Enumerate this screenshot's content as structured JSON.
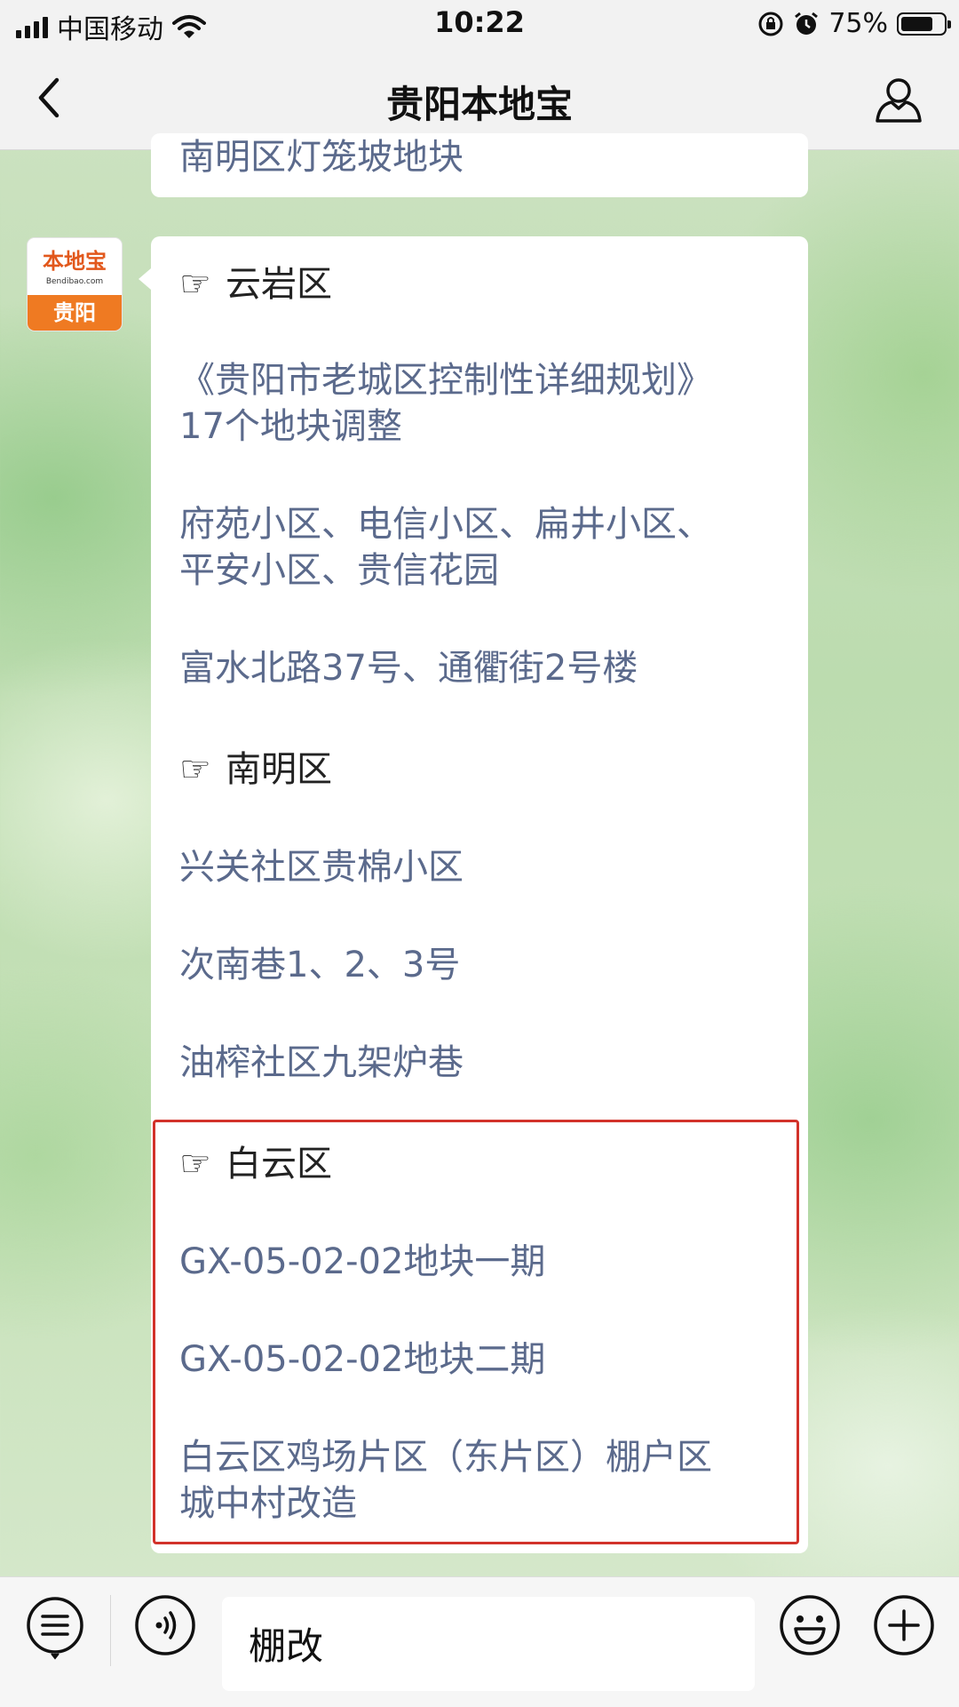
{
  "status_bar": {
    "carrier": "中国移动",
    "time": "10:22",
    "battery_percent": "75%",
    "battery_level": 0.75,
    "icons": [
      "signal-icon",
      "wifi-icon",
      "orientation-lock-icon",
      "alarm-icon",
      "battery-icon"
    ]
  },
  "nav": {
    "title": "贵阳本地宝",
    "back_icon": "chevron-left-icon",
    "profile_icon": "person-icon"
  },
  "previous_message": {
    "partial_text": "南明区灯笼坡地块"
  },
  "avatar": {
    "brand_text": "本地宝",
    "site_text": "Bendibao.com",
    "city_text": "贵阳",
    "accent_color": "#ef7a22"
  },
  "message": {
    "sections": [
      {
        "district": "云岩区",
        "items": [
          [
            "《贵阳市老城区控制性详细规划》",
            "17个地块调整"
          ],
          [
            "府苑小区、电信小区、扁井小区、",
            "平安小区、贵信花园"
          ],
          [
            "富水北路37号、通衢街2号楼"
          ]
        ]
      },
      {
        "district": "南明区",
        "items": [
          [
            "兴关社区贵棉小区"
          ],
          [
            "次南巷1、2、3号"
          ],
          [
            "油榨社区九架炉巷"
          ]
        ]
      },
      {
        "district": "白云区",
        "highlighted": true,
        "highlight_color": "#d2322a",
        "items": [
          [
            "GX-05-02-02地块一期"
          ],
          [
            "GX-05-02-02地块二期"
          ],
          [
            "白云区鸡场片区（东片区）棚户区",
            "城中村改造"
          ]
        ]
      }
    ],
    "text_color": "#5b6a8c",
    "bullet_icon": "pointing-hand-icon"
  },
  "input_bar": {
    "menu_icon": "menu-list-icon",
    "voice_icon": "voice-icon",
    "input_text": "棚改",
    "emoji_icon": "emoji-icon",
    "plus_icon": "plus-icon"
  }
}
